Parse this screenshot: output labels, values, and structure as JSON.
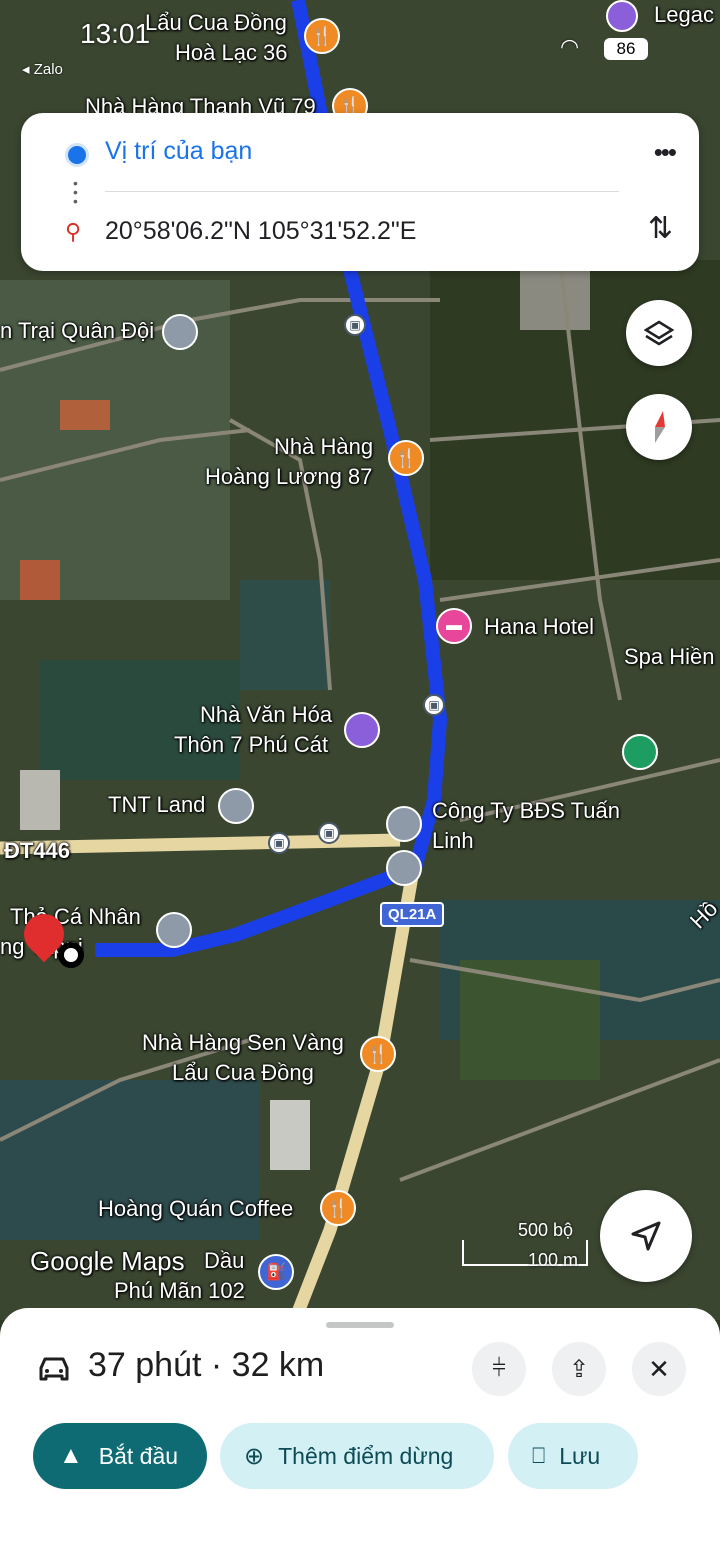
{
  "status_bar": {
    "time": "13:01",
    "back_app": "Zalo",
    "battery": "86"
  },
  "directions": {
    "origin": "Vị trí của bạn",
    "destination": "20°58'06.2\"N 105°31'52.2\"E"
  },
  "map_labels": {
    "lau_cua_dong_line1": "Lẩu Cua Đồng",
    "lau_cua_dong_line2": "Hoà Lạc 36",
    "thanh_vu": "Nhà Hàng Thanh Vũ 79",
    "legacy": "Legac",
    "trai_quan_doi": "n Trại Quân Đội",
    "hoang_luong_line1": "Nhà Hàng",
    "hoang_luong_line2": "Hoàng Lương 87",
    "hana": "Hana Hotel",
    "spa": "Spa Hiền",
    "van_hoa_line1": "Nhà Văn Hóa",
    "van_hoa_line2": "Thôn 7 Phú Cát",
    "tnt": "TNT Land",
    "bds_line1": "Công Ty BĐS Tuấn",
    "bds_line2": "Linh",
    "dt446": "ĐT446",
    "ql21a": "QL21A",
    "tha_ca_line1": "Thả Cá Nhân",
    "tha_ca_line2": "ng     Tappi",
    "sen_vang_line1": "Nhà Hàng Sen Vàng",
    "sen_vang_line2": "Lẩu Cua Đồng",
    "hoang_quan": "Hoàng Quán Coffee",
    "google_logo": "Google Maps",
    "dau_line1": "Dầu",
    "dau_line2": "Phú Mãn 102",
    "ho": "Hồ",
    "scale_ft": "500 bộ",
    "scale_m": "100 m"
  },
  "trip": {
    "summary": "37 phút · 32 km"
  },
  "actions": {
    "start": "Bắt đầu",
    "add_stop": "Thêm điểm dừng",
    "save": "Lưu"
  },
  "colors": {
    "route": "#1a3fe8",
    "accent": "#1a73e8",
    "start_bg": "#0e6b73",
    "pill_bg": "#d3f0f5"
  }
}
